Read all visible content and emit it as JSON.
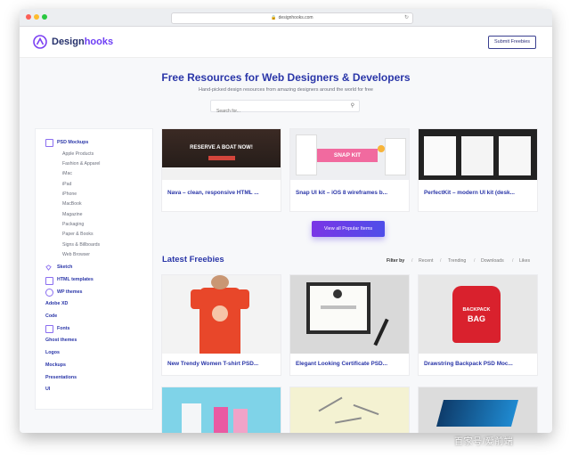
{
  "browser": {
    "url": "designhooks.com"
  },
  "header": {
    "logo_text_a": "Design",
    "logo_text_b": "hooks",
    "submit_label": "Submit Freebies"
  },
  "hero": {
    "title": "Free Resources for Web Designers & Developers",
    "subtitle": "Hand-picked design resources from amazing designers around the world for free",
    "search_placeholder": "Search for..."
  },
  "sidebar": {
    "psd_mockups": "PSD Mockups",
    "psd_items": [
      "Apple Products",
      "Fashion & Apparel",
      "iMac",
      "iPad",
      "iPhone",
      "MacBook",
      "Magazine",
      "Packaging",
      "Paper & Books",
      "Signs & Billboards",
      "Web Browser"
    ],
    "sketch": "Sketch",
    "html_templates": "HTML templates",
    "wp_themes": "WP themes",
    "adobe_xd": "Adobe XD",
    "code": "Code",
    "fonts": "Fonts",
    "ghost_themes": "Ghost themes",
    "logos": "Logos",
    "mockups": "Mockups",
    "presentations": "Presentations",
    "ui": "UI"
  },
  "popular": {
    "cards": [
      {
        "caption": "Nava – clean, responsive HTML ...",
        "thumb_text": "RESERVE A BOAT NOW!"
      },
      {
        "caption": "Snap UI kit – iOS 8 wireframes b...",
        "thumb_text": "SNAP KIT"
      },
      {
        "caption": "PerfectKit – modern UI kit (desk..."
      }
    ],
    "view_all_label": "View all Popular Items"
  },
  "latest": {
    "title": "Latest Freebies",
    "filter_label": "Filter by",
    "filters": [
      "Recent",
      "Trending",
      "Downloads",
      "Likes"
    ],
    "cards": [
      {
        "caption": "New Trendy Women T-shirt PSD..."
      },
      {
        "caption": "Elegant Looking Certificate PSD..."
      },
      {
        "caption": "Drawstring Backpack PSD Moc...",
        "thumb_text_a": "BACKPACK",
        "thumb_text_b": "BAG"
      }
    ]
  },
  "watermark": "百家号/爱前端"
}
